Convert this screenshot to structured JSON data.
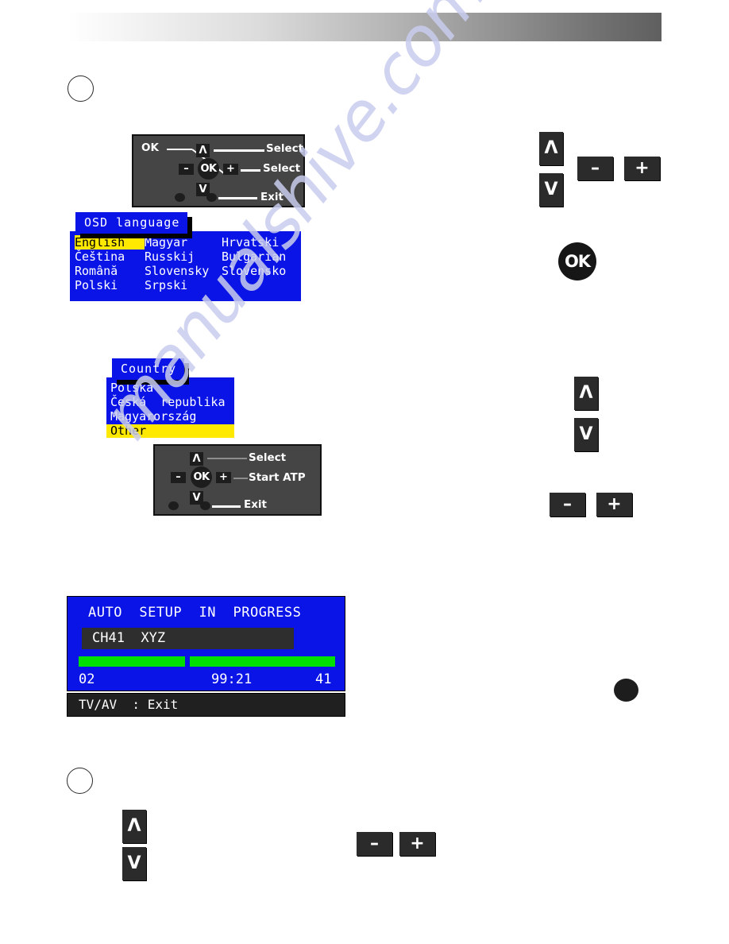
{
  "header": {
    "gradient_from": "#ffffff",
    "gradient_to": "#5f5f5f"
  },
  "steps": {
    "step1_label": "",
    "step2_label": ""
  },
  "watermark": {
    "text": "manualshive.com",
    "color": "#c9cdee"
  },
  "remote_diagram_1": {
    "ok_callout": "OK",
    "up_key": "Λ",
    "down_key": "V",
    "minus_key": "–",
    "plus_key": "+",
    "ok_key": "OK",
    "label_up": "Select",
    "label_mid": "Select",
    "label_bottom": "Exit"
  },
  "remote_diagram_2": {
    "up_key": "Λ",
    "down_key": "V",
    "minus_key": "–",
    "plus_key": "+",
    "ok_key": "OK",
    "label_up": "Select",
    "label_mid": "Start  ATP",
    "label_bottom": "Exit"
  },
  "osd_language": {
    "title": "OSD  language",
    "selected": "English",
    "columns": [
      [
        "English",
        "Čeština",
        "Română",
        "Polski"
      ],
      [
        "Magyar",
        "Russkij",
        "Slovensky",
        "Srpski"
      ],
      [
        "Hrvatski",
        "Bulgarian",
        "Slovensko",
        ""
      ]
    ],
    "bg_color": "#0a14e6",
    "highlight_color": "#ffe900"
  },
  "osd_country": {
    "title": "Country",
    "items": [
      "Polska",
      "Česká  republika",
      "Magyarország"
    ],
    "selected": "Other",
    "bg_color": "#0a14e6",
    "highlight_color": "#ffe900"
  },
  "auto_setup": {
    "heading": "AUTO  SETUP  IN  PROGRESS",
    "channel": "CH41  XYZ",
    "progress_left_pct": 38,
    "progress_right_pct": 52,
    "program_number": "02",
    "frequency": "99:21",
    "channel_number": "41",
    "footer": "TV/AV  : Exit",
    "bg_color": "#0a14e6",
    "bar_color": "#00e000"
  },
  "keys_group_1": {
    "up": "Λ",
    "down": "V",
    "minus": "–",
    "plus": "+",
    "ok": "OK"
  },
  "keys_group_2": {
    "up": "Λ",
    "down": "V",
    "minus": "–",
    "plus": "+"
  },
  "keys_group_3": {
    "up": "Λ",
    "down": "V",
    "minus": "–",
    "plus": "+"
  }
}
